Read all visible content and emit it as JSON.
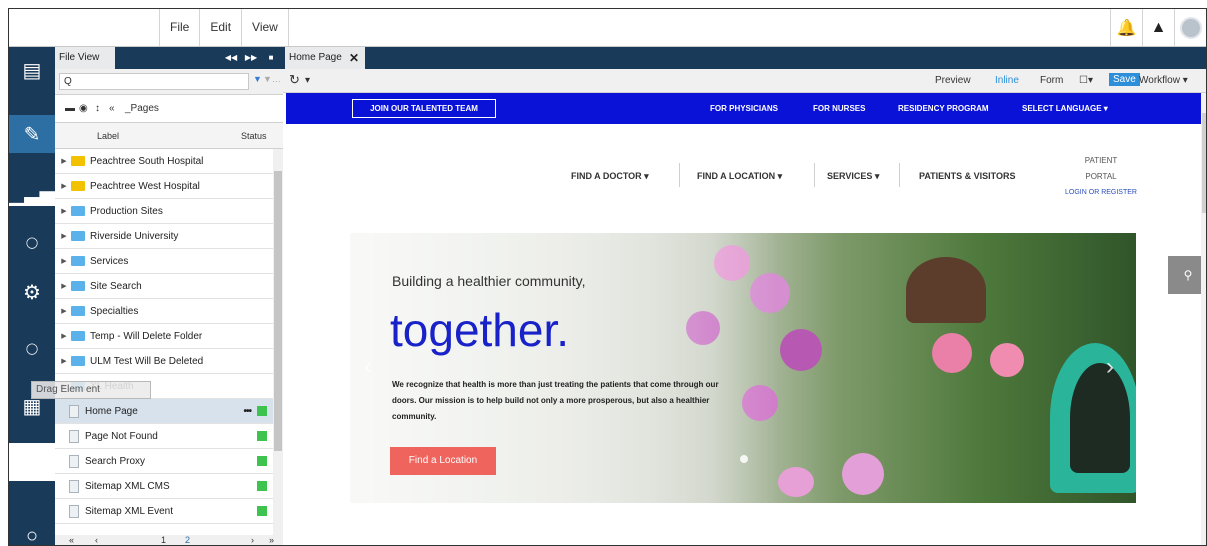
{
  "menubar": {
    "items": [
      "File",
      "Edit",
      "View"
    ]
  },
  "fileview": {
    "tab_label": "File View",
    "search_value": "Q",
    "path": "_Pages",
    "col_label": "Label",
    "col_status": "Status",
    "items": [
      {
        "label": "Peachtree South Hospital",
        "type": "folder-yellow"
      },
      {
        "label": "Peachtree West Hospital",
        "type": "folder-yellow"
      },
      {
        "label": "Production Sites",
        "type": "folder"
      },
      {
        "label": "Riverside University",
        "type": "folder"
      },
      {
        "label": "Services",
        "type": "folder"
      },
      {
        "label": "Site Search",
        "type": "folder"
      },
      {
        "label": "Specialties",
        "type": "folder"
      },
      {
        "label": "Temp - Will Delete Folder",
        "type": "folder"
      },
      {
        "label": "ULM Test Will Be Deleted",
        "type": "folder"
      },
      {
        "label": "XL Health",
        "type": "folder"
      },
      {
        "label": "Home Page",
        "type": "page",
        "selected": true
      },
      {
        "label": "Page Not Found",
        "type": "page"
      },
      {
        "label": "Search Proxy",
        "type": "page"
      },
      {
        "label": "Sitemap XML CMS",
        "type": "page"
      },
      {
        "label": "Sitemap XML Event",
        "type": "page"
      }
    ],
    "pager_current": "1",
    "pager_next": "2",
    "drag_ghost": "Drag Elem ent"
  },
  "editor": {
    "tab_label": "Home Page",
    "toolbar": {
      "preview": "Preview",
      "inline": "Inline",
      "form": "Form",
      "save": "Save",
      "workflow": "Workflow"
    }
  },
  "site": {
    "join": "JOIN OUR TALENTED TEAM",
    "top_links": [
      "FOR PHYSICIANS",
      "FOR NURSES",
      "RESIDENCY PROGRAM",
      "SELECT LANGUAGE"
    ],
    "nav": [
      "FIND A DOCTOR",
      "FIND A LOCATION",
      "SERVICES",
      "PATIENTS & VISITORS"
    ],
    "portal_line1": "PATIENT",
    "portal_line2": "PORTAL",
    "portal_login": "LOGIN OR REGISTER",
    "hero_sub": "Building a healthier community,",
    "hero_big": "together.",
    "hero_body": "We recognize that health is more than just treating the patients that come through our doors. Our mission is to help build not only a more prosperous, but also a healthier community.",
    "hero_btn": "Find a Location"
  },
  "colors": {
    "nav_dark": "#1a3a5a",
    "site_blue": "#0b12d8",
    "hero_title": "#1822c8",
    "cta": "#f0645e",
    "status_green": "#3ec34f"
  }
}
